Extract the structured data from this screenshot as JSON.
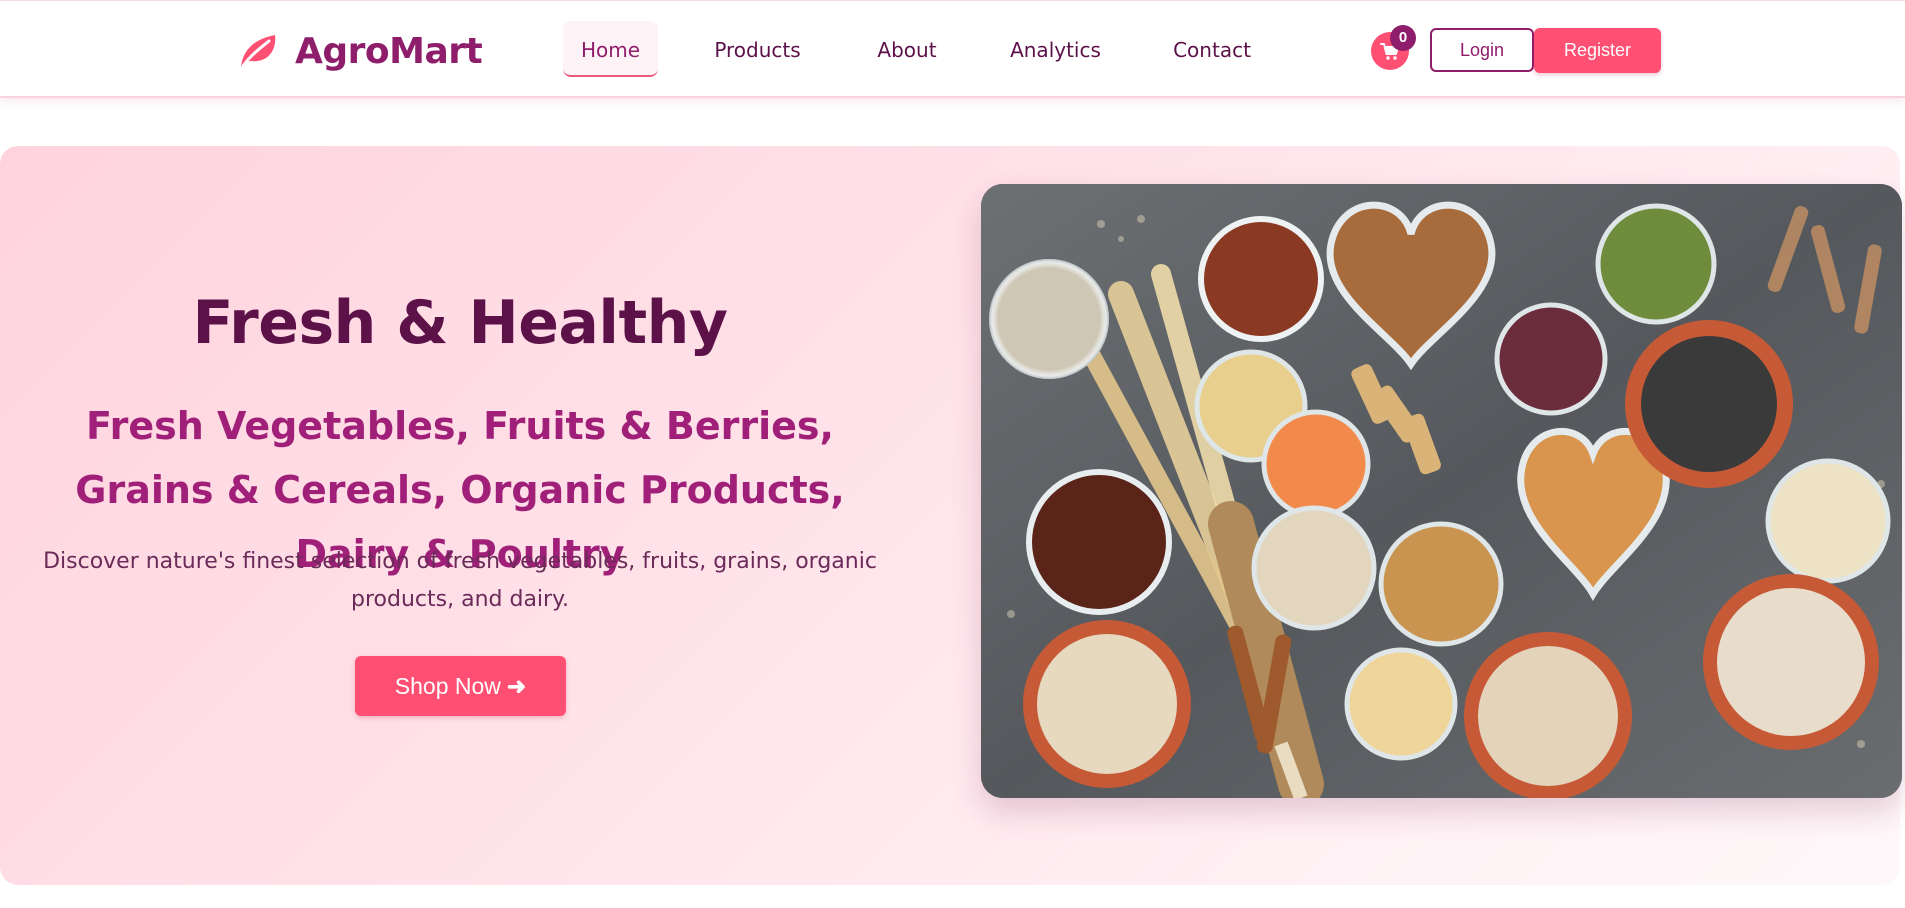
{
  "brand": {
    "name": "AgroMart",
    "icon": "leaf-icon",
    "color": "#8e1d6b"
  },
  "nav": {
    "items": [
      {
        "label": "Home",
        "active": true
      },
      {
        "label": "Products",
        "active": false
      },
      {
        "label": "About",
        "active": false
      },
      {
        "label": "Analytics",
        "active": false
      },
      {
        "label": "Contact",
        "active": false
      }
    ],
    "cart": {
      "icon": "cart-icon",
      "count": "0"
    },
    "login_label": "Login",
    "register_label": "Register"
  },
  "hero": {
    "title": "Fresh & Healthy",
    "subtitle": "Fresh Vegetables, Fruits & Berries, Grains & Cereals, Organic Products, Dairy & Poultry",
    "description": "Discover nature's finest selection of fresh vegetables, fruits, grains, organic products, and dairy.",
    "cta_label": "Shop Now",
    "cta_icon": "arrow-right-icon",
    "image": "grains-seeds-pasta-bowls"
  },
  "colors": {
    "primary": "#8e1d6b",
    "dark": "#5c1148",
    "accent": "#ff4f73",
    "hero_bg": "#ffe3ea"
  }
}
